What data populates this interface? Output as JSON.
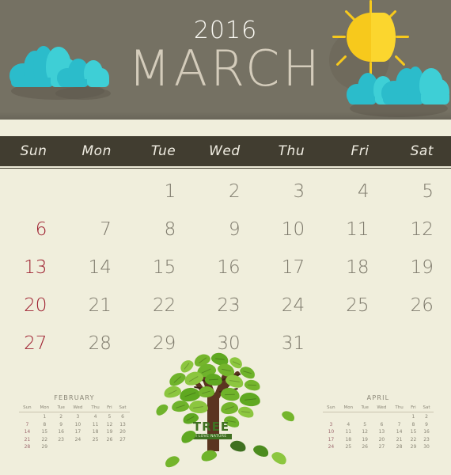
{
  "header": {
    "year": "2016",
    "month": "MARCH",
    "bg_color": "#757163",
    "year_color": "#FBFAF4",
    "month_color": "#D4CCBB",
    "icons": {
      "sun": "sun-icon",
      "cloud_left": "cloud-icon",
      "cloud_right": "cloud-icon"
    },
    "sun_color": "#F7C91C",
    "cloud_color": "#2BBCCB"
  },
  "weekdays": [
    "Sun",
    "Mon",
    "Tue",
    "Wed",
    "Thu",
    "Fri",
    "Sat"
  ],
  "weekbar": {
    "bg_color": "#413D30",
    "text_color": "#F0EDE2"
  },
  "colors": {
    "page_bg": "#F0EEDC",
    "date_text": "#7E7A6C",
    "sunday_text": "#9E2030",
    "mini_text": "#8A8677"
  },
  "grid": {
    "rows": [
      [
        "",
        "",
        "1",
        "2",
        "3",
        "4",
        "5"
      ],
      [
        "6",
        "7",
        "8",
        "9",
        "10",
        "11",
        "12"
      ],
      [
        "13",
        "14",
        "15",
        "16",
        "17",
        "18",
        "19"
      ],
      [
        "20",
        "21",
        "22",
        "23",
        "24",
        "25",
        "26"
      ],
      [
        "27",
        "28",
        "29",
        "30",
        "31",
        "",
        ""
      ]
    ]
  },
  "mini_prev": {
    "title": "FEBRUARY",
    "weekdays": [
      "Sun",
      "Mon",
      "Tue",
      "Wed",
      "Thu",
      "Fri",
      "Sat"
    ],
    "rows": [
      [
        "",
        "1",
        "2",
        "3",
        "4",
        "5",
        "6"
      ],
      [
        "7",
        "8",
        "9",
        "10",
        "11",
        "12",
        "13"
      ],
      [
        "14",
        "15",
        "16",
        "17",
        "18",
        "19",
        "20"
      ],
      [
        "21",
        "22",
        "23",
        "24",
        "25",
        "26",
        "27"
      ],
      [
        "28",
        "29",
        "",
        "",
        "",
        "",
        ""
      ]
    ]
  },
  "mini_next": {
    "title": "APRIL",
    "weekdays": [
      "Sun",
      "Mon",
      "Tue",
      "Wed",
      "Thu",
      "Fri",
      "Sat"
    ],
    "rows": [
      [
        "",
        "",
        "",
        "",
        "",
        "1",
        "2"
      ],
      [
        "3",
        "4",
        "5",
        "6",
        "7",
        "8",
        "9"
      ],
      [
        "10",
        "11",
        "12",
        "13",
        "14",
        "15",
        "16"
      ],
      [
        "17",
        "18",
        "19",
        "20",
        "21",
        "22",
        "23"
      ],
      [
        "24",
        "25",
        "26",
        "27",
        "28",
        "29",
        "30"
      ]
    ]
  },
  "tree": {
    "label": "TREE",
    "tagline": "I LOVE NATURE",
    "leaf_color": "#6FB32B",
    "trunk_color": "#5B3520",
    "label_color": "#3F7021"
  }
}
